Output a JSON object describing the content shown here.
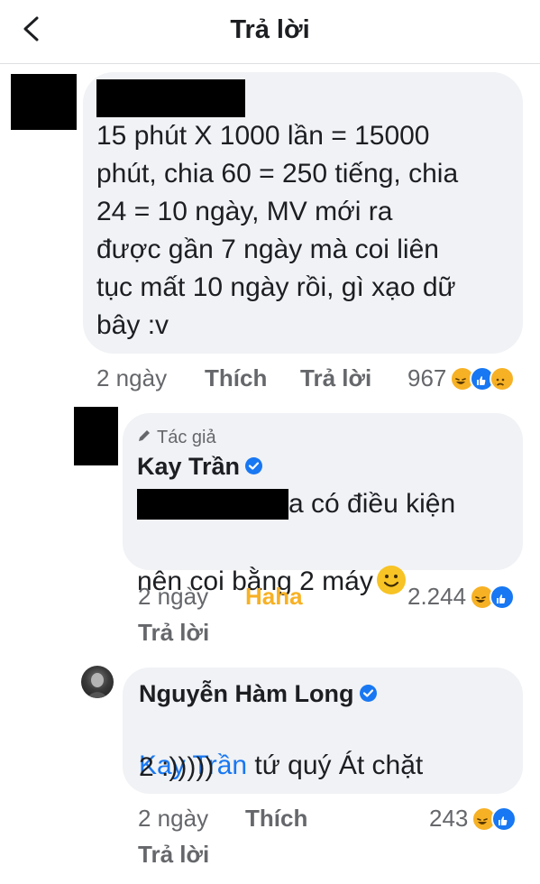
{
  "header": {
    "title": "Trả lời",
    "back_icon": "chevron-left-icon"
  },
  "comments": [
    {
      "text": "15 phút X 1000 lần = 15000\nphút, chia 60 = 250 tiếng, chia\n24 = 10 ngày,  MV mới ra\nđược gần 7 ngày mà coi liên\ntục mất 10 ngày rồi, gì xạo dữ\nbây :v",
      "time": "2 ngày",
      "like_label": "Thích",
      "reply_label": "Trả lời",
      "reaction_count": "967",
      "reactions": [
        "haha",
        "like",
        "sad"
      ]
    },
    {
      "author_tag": "Tác giả",
      "author": "Kay Trần",
      "verified": true,
      "text_line1": "a có điều kiện",
      "text_line2": "nên coi bằng 2 máy",
      "time": "2 ngày",
      "reaction_label": "Haha",
      "reaction_label_color": "#f7b125",
      "reply_label": "Trả lời",
      "reaction_count": "2.244",
      "reactions": [
        "haha",
        "like"
      ]
    },
    {
      "author": "Nguyễn Hàm Long",
      "verified": true,
      "mention": "Kay Trần",
      "text_line1": "tứ quý Át chặt",
      "text_line2": "2 :)))))",
      "time": "2 ngày",
      "like_label": "Thích",
      "reply_label": "Trả lời",
      "reaction_count": "243",
      "reactions": [
        "haha",
        "like"
      ]
    }
  ],
  "colors": {
    "bubble": "#f0f2f5",
    "link": "#1877f2",
    "meta": "#65676b",
    "haha": "#f7b125"
  }
}
